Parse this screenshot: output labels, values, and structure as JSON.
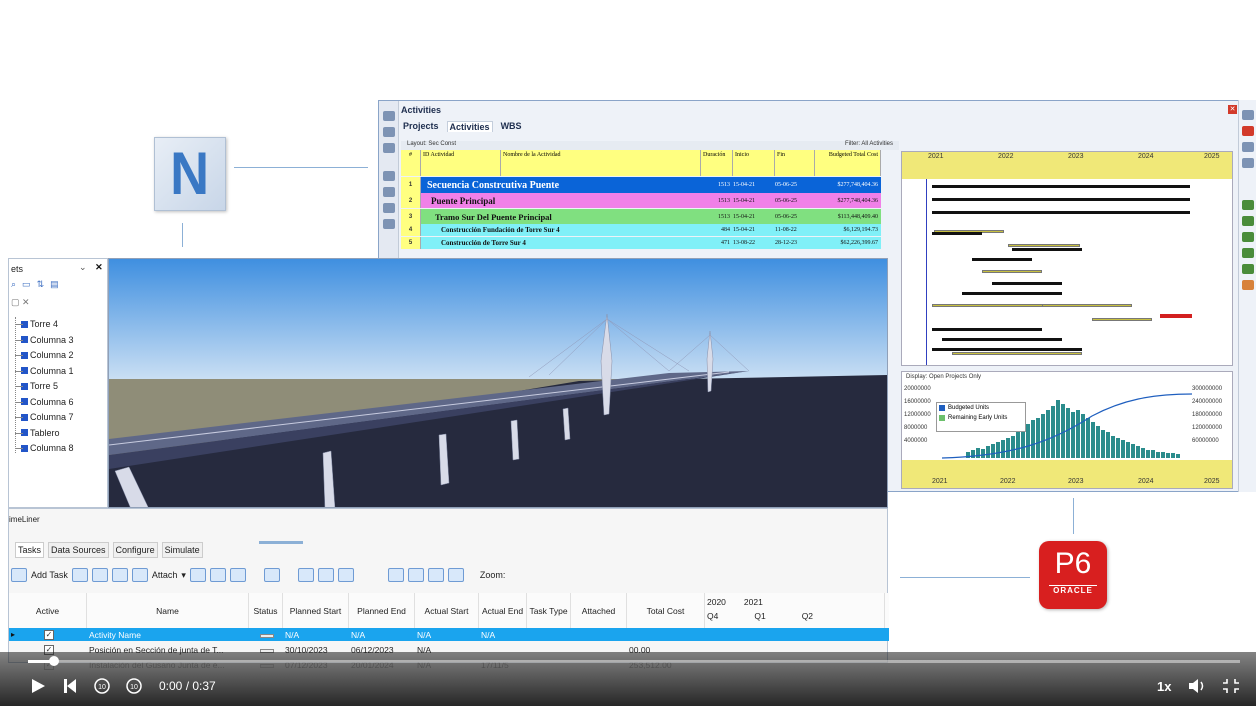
{
  "logos": {
    "navisworks_letter": "N",
    "p6_text": "P6",
    "p6_brand": "ORACLE"
  },
  "p6": {
    "window_title": "Activities",
    "tabs": [
      "Projects",
      "Activities",
      "WBS"
    ],
    "layout_label": "Layout: Sec Const",
    "filter_label": "Filter: All Activities",
    "columns": [
      "#",
      "ID Actividad",
      "Nombre de la Actividad",
      "Duración",
      "Inicio",
      "Fin",
      "Budgeted Total Cost"
    ],
    "rows": [
      {
        "num": "1",
        "name": "Secuencia Constrcutiva Puente",
        "dur": "1513",
        "start": "15-04-21",
        "end": "05-06-25",
        "cost": "$277,748,404.36",
        "color": "#0a64d8",
        "text": "#ffffff"
      },
      {
        "num": "2",
        "name": "Puente Principal",
        "dur": "1513",
        "start": "15-04-21",
        "end": "05-06-25",
        "cost": "$277,748,404.36",
        "color": "#f080e8",
        "text": "#111111"
      },
      {
        "num": "3",
        "name": "Tramo Sur Del Puente Principal",
        "dur": "1513",
        "start": "15-04-21",
        "end": "05-06-25",
        "cost": "$113,448,409.40",
        "color": "#80e080",
        "text": "#111111"
      },
      {
        "num": "4",
        "name": "Construcción Fundación de Torre Sur 4",
        "dur": "484",
        "start": "15-04-21",
        "end": "11-08-22",
        "cost": "$6,129,194.73",
        "color": "#80f0f8",
        "text": "#111111"
      },
      {
        "num": "5",
        "name": "Construcción de Torre Sur 4",
        "dur": "471",
        "start": "13-08-22",
        "end": "28-12-23",
        "cost": "$62,226,399.67",
        "color": "#80f0f8",
        "text": "#111111"
      }
    ],
    "gantt_years": [
      "2021",
      "2022",
      "2023",
      "2024",
      "2025"
    ],
    "histogram": {
      "display_label": "Display: Open Projects Only",
      "legend": [
        "Budgeted Units",
        "Remaining Early Units"
      ],
      "left_axis": [
        "20000000",
        "16000000",
        "12000000",
        "8000000",
        "4000000"
      ],
      "right_axis": [
        "300000000",
        "240000000",
        "180000000",
        "120000000",
        "60000000"
      ],
      "colors": {
        "budgeted": "#1f5fbf",
        "remaining": "#6cc06c"
      }
    }
  },
  "sets_panel": {
    "title": "ets",
    "items": [
      "Torre 4",
      "Columna 3",
      "Columna 2",
      "Columna 1",
      "Torre 5",
      "Columna 6",
      "Columna 7",
      "Tablero",
      "Columna 8"
    ]
  },
  "timeliner": {
    "title": "imeLiner",
    "tabs": [
      "Tasks",
      "Data Sources",
      "Configure",
      "Simulate"
    ],
    "add_task": "Add Task",
    "attach": "Attach",
    "zoom_label": "Zoom:",
    "columns": [
      "Active",
      "Name",
      "Status",
      "Planned Start",
      "Planned End",
      "Actual Start",
      "Actual End",
      "Task Type",
      "Attached",
      "Total Cost"
    ],
    "timeline_years": [
      "2020",
      "2021"
    ],
    "timeline_quarters": [
      "Q4",
      "Q1",
      "Q2"
    ],
    "rows": [
      {
        "name": "Activity Name",
        "ps": "N/A",
        "pe": "N/A",
        "as": "N/A",
        "ae": "N/A",
        "cost": "",
        "selected": true
      },
      {
        "name": "Posición en Sección de  junta de T...",
        "ps": "30/10/2023",
        "pe": "06/12/2023",
        "as": "N/A",
        "ae": "",
        "cost": "00.00",
        "selected": false
      },
      {
        "name": "Instalación del Gusano Junta de e...",
        "ps": "07/12/2023",
        "pe": "20/01/2024",
        "as": "N/A",
        "ae": "17/11/5",
        "cost": "253,512.00",
        "selected": false
      }
    ]
  },
  "player": {
    "time": "0:00 / 0:37",
    "speed": "1x",
    "progress": 0.02
  }
}
